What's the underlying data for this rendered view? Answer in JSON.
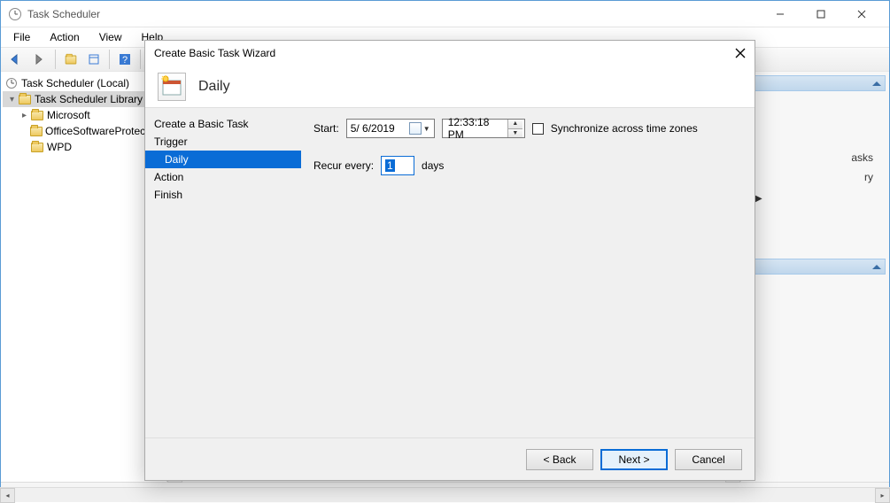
{
  "window": {
    "title": "Task Scheduler",
    "menu": {
      "file": "File",
      "action": "Action",
      "view": "View",
      "help": "Help"
    }
  },
  "tree": {
    "root": "Task Scheduler (Local)",
    "library": "Task Scheduler Library",
    "items": [
      "Microsoft",
      "OfficeSoftwareProtectionPlatform",
      "WPD"
    ]
  },
  "actions_panel": {
    "item1": "asks",
    "item2": "ry"
  },
  "wizard": {
    "title": "Create Basic Task Wizard",
    "banner_title": "Daily",
    "nav": {
      "step1": "Create a Basic Task",
      "step2": "Trigger",
      "step3": "Daily",
      "step4": "Action",
      "step5": "Finish"
    },
    "labels": {
      "start": "Start:",
      "recur": "Recur every:",
      "days": "days",
      "sync": "Synchronize across time zones"
    },
    "values": {
      "date": "5/ 6/2019",
      "time": "12:33:18 PM",
      "recur_days": "1"
    },
    "buttons": {
      "back": "< Back",
      "next": "Next >",
      "cancel": "Cancel"
    }
  }
}
